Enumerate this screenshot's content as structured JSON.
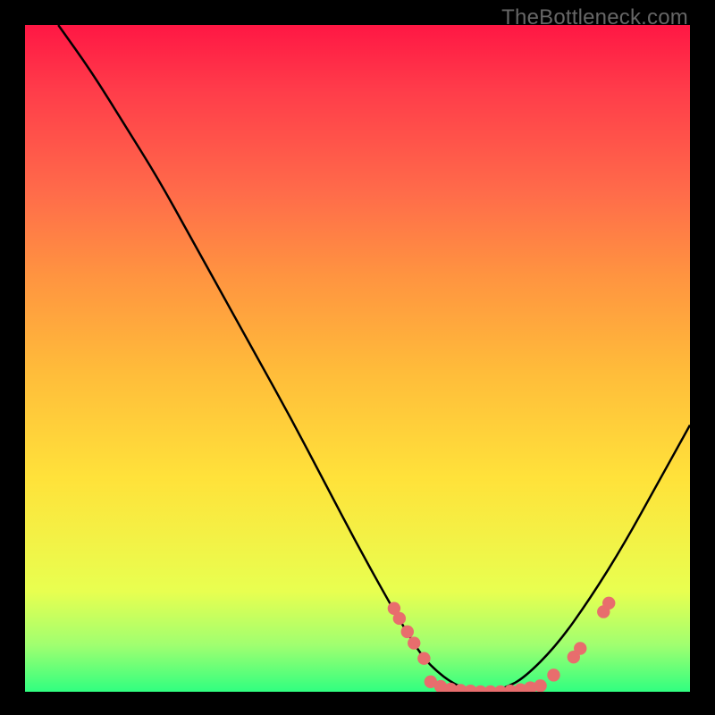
{
  "watermark": "TheBottleneck.com",
  "chart_data": {
    "type": "line",
    "title": "",
    "xlabel": "",
    "ylabel": "",
    "xlim": [
      0,
      100
    ],
    "ylim": [
      0,
      100
    ],
    "series": [
      {
        "name": "curve",
        "x": [
          5,
          10,
          15,
          20,
          25,
          30,
          35,
          40,
          45,
          50,
          55,
          58,
          60,
          62,
          64,
          66,
          68,
          70,
          72,
          75,
          80,
          85,
          90,
          95,
          100
        ],
        "y": [
          100,
          93,
          85,
          77,
          68,
          59,
          50,
          41,
          31.5,
          22,
          13,
          8,
          5,
          3,
          1.5,
          0.5,
          0,
          0,
          0.5,
          2,
          7,
          14,
          22,
          31,
          40
        ]
      }
    ],
    "markers": [
      {
        "x": 55.5,
        "y": 12.5
      },
      {
        "x": 56.3,
        "y": 11.0
      },
      {
        "x": 57.5,
        "y": 9.0
      },
      {
        "x": 58.5,
        "y": 7.3
      },
      {
        "x": 60.0,
        "y": 5.0
      },
      {
        "x": 61.0,
        "y": 1.5
      },
      {
        "x": 62.5,
        "y": 0.8
      },
      {
        "x": 64.0,
        "y": 0.4
      },
      {
        "x": 65.5,
        "y": 0.2
      },
      {
        "x": 67.0,
        "y": 0.1
      },
      {
        "x": 68.5,
        "y": 0.0
      },
      {
        "x": 70.0,
        "y": 0.0
      },
      {
        "x": 71.5,
        "y": 0.0
      },
      {
        "x": 73.0,
        "y": 0.1
      },
      {
        "x": 74.5,
        "y": 0.3
      },
      {
        "x": 76.0,
        "y": 0.6
      },
      {
        "x": 77.5,
        "y": 0.9
      },
      {
        "x": 79.5,
        "y": 2.5
      },
      {
        "x": 82.5,
        "y": 5.2
      },
      {
        "x": 83.5,
        "y": 6.5
      },
      {
        "x": 87.0,
        "y": 12.0
      },
      {
        "x": 87.8,
        "y": 13.3
      }
    ],
    "gradient_stops": [
      {
        "pos": 0,
        "color": "#ff1744"
      },
      {
        "pos": 50,
        "color": "#ffcc33"
      },
      {
        "pos": 100,
        "color": "#30ff80"
      }
    ]
  }
}
